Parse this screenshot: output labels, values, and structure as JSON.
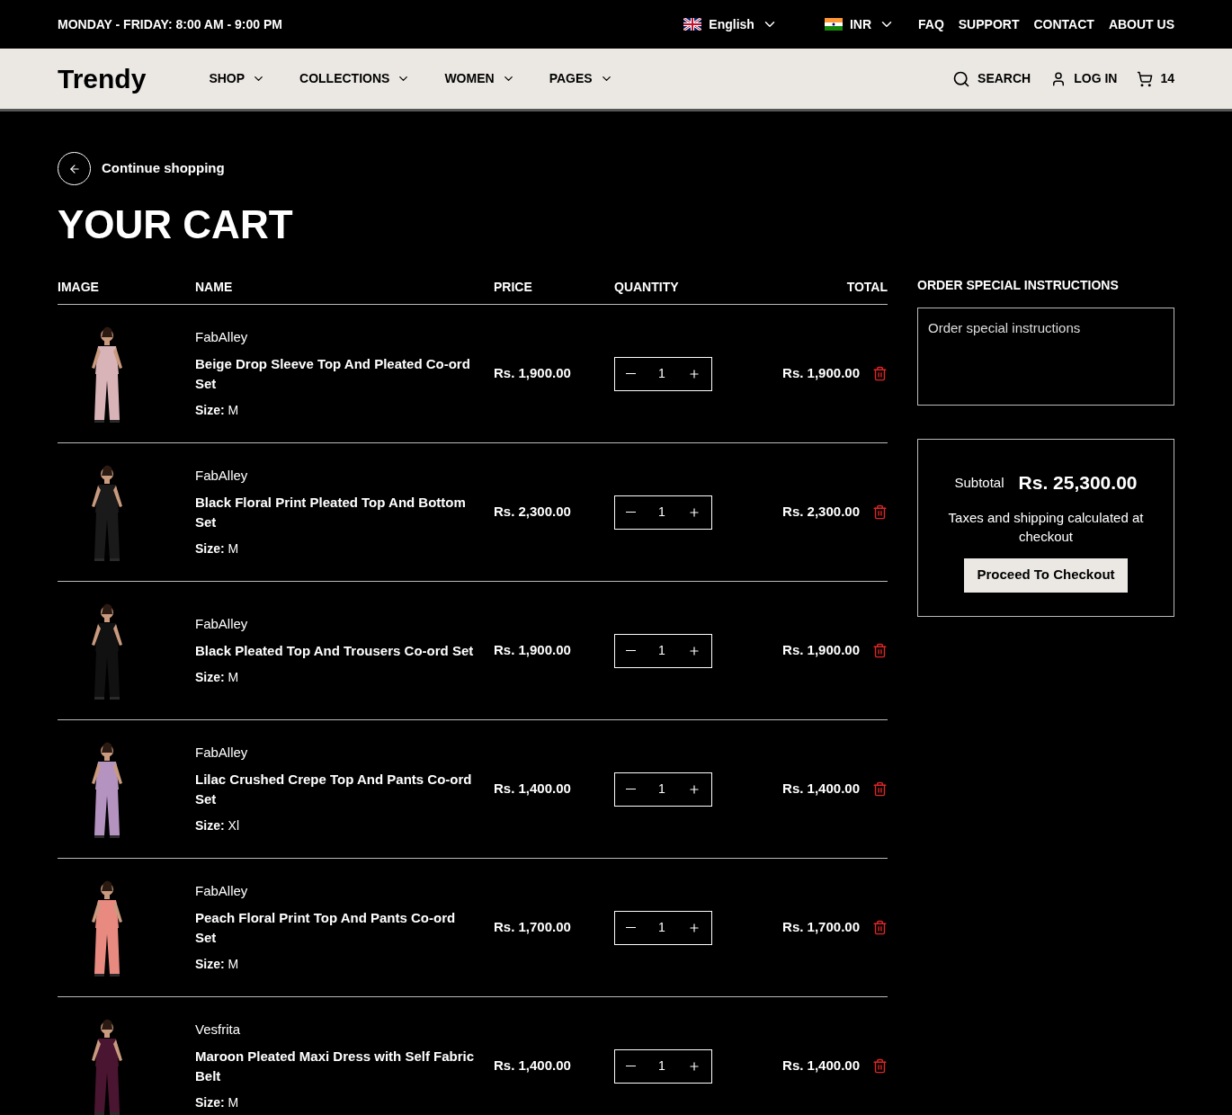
{
  "top_bar": {
    "hours": "MONDAY - FRIDAY: 8:00 AM - 9:00 PM",
    "language": "English",
    "currency": "INR",
    "links": [
      "FAQ",
      "SUPPORT",
      "CONTACT",
      "ABOUT US"
    ]
  },
  "header": {
    "logo": "Trendy",
    "nav": [
      "SHOP",
      "COLLECTIONS",
      "WOMEN",
      "PAGES"
    ],
    "search": "SEARCH",
    "login": "LOG IN",
    "cart_count": "14"
  },
  "back_link": "Continue shopping",
  "title": "YOUR CART",
  "table": {
    "columns": [
      "IMAGE",
      "NAME",
      "PRICE",
      "QUANTITY",
      "TOTAL"
    ],
    "rows": [
      {
        "brand": "FabAlley",
        "name": "Beige Drop Sleeve Top And Pleated Co-ord Set",
        "size": "**Size:** M",
        "price": "Rs. 1,900.00",
        "quantity": "1",
        "total": "Rs. 1,900.00"
      },
      {
        "brand": "FabAlley",
        "name": "Black Floral Print Pleated Top And Bottom Set",
        "size": "**Size:** M",
        "price": "Rs. 2,300.00",
        "quantity": "1",
        "total": "Rs. 2,300.00"
      },
      {
        "brand": "FabAlley",
        "name": "Black Pleated Top And Trousers Co-ord Set",
        "size": "**Size:** M",
        "price": "Rs. 1,900.00",
        "quantity": "1",
        "total": "Rs. 1,900.00"
      },
      {
        "brand": "FabAlley",
        "name": "Lilac Crushed Crepe Top And Pants Co-ord Set",
        "size": "**Size:** Xl",
        "price": "Rs. 1,400.00",
        "quantity": "1",
        "total": "Rs. 1,400.00"
      },
      {
        "brand": "FabAlley",
        "name": "Peach Floral Print Top And Pants Co-ord Set",
        "size": "**Size:** M",
        "price": "Rs. 1,700.00",
        "quantity": "1",
        "total": "Rs. 1,700.00"
      },
      {
        "brand": "Vesfrita",
        "name": "Maroon Pleated Maxi Dress with Self Fabric Belt",
        "size": "**Size:** M",
        "price": "Rs. 1,400.00",
        "quantity": "1",
        "total": "Rs. 1,400.00"
      }
    ]
  },
  "sidebar": {
    "instructions_label": "ORDER SPECIAL INSTRUCTIONS",
    "instructions_placeholder": "Order special instructions",
    "subtotal_label": "Subtotal",
    "subtotal": "Rs. 25,300.00",
    "tax_note": "Taxes and shipping calculated at checkout",
    "checkout": "Proceed To Checkout"
  }
}
